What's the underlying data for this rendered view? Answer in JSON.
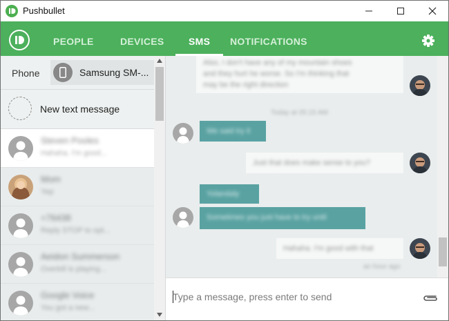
{
  "window": {
    "title": "Pushbullet"
  },
  "tabs": [
    {
      "label": "PEOPLE"
    },
    {
      "label": "DEVICES"
    },
    {
      "label": "SMS"
    },
    {
      "label": "NOTIFICATIONS"
    }
  ],
  "sidebar": {
    "phone_label": "Phone",
    "device_name": "Samsung SM-...",
    "new_message_label": "New text message",
    "contacts": [
      {
        "name": "Steven Pooles",
        "preview": "Hahaha. I'm good..."
      },
      {
        "name": "Mom",
        "preview": "Yep"
      },
      {
        "name": "+76438",
        "preview": "Reply STOP to opt..."
      },
      {
        "name": "Aeidon Summerson",
        "preview": "Overkill is playing..."
      },
      {
        "name": "Google Voice",
        "preview": "You got a new..."
      }
    ]
  },
  "chat": {
    "messages": [
      {
        "dir": "out",
        "text1": "Also, I don't have any of my mountain shoes",
        "text2": "and they hurt he worse. So I'm thinking that",
        "text3": "may be the right direction"
      },
      {
        "dir": "stamp",
        "text": "Today at 05:15 AM"
      },
      {
        "dir": "in",
        "text1": "We said try it"
      },
      {
        "dir": "out",
        "text1": "Just that does make sense to you?"
      },
      {
        "dir": "in",
        "text1": "Yolandaly"
      },
      {
        "dir": "in",
        "text1": "Sometimes you just have to try until"
      },
      {
        "dir": "out",
        "text1": "Hahaha. I'm good with that"
      },
      {
        "dir": "stamp",
        "text": "an hour ago"
      }
    ]
  },
  "compose": {
    "placeholder": "Type a message, press enter to send"
  },
  "colors": {
    "brand_green": "#4cb05c",
    "incoming_bubble": "#5aa2a2",
    "sidebar_bg": "#e8ecec"
  },
  "icons": {
    "titlebar": [
      "pushbullet-logo-icon",
      "minimize-icon",
      "maximize-icon",
      "close-icon"
    ],
    "toolbar": [
      "pushbullet-brand-icon",
      "gear-icon"
    ],
    "compose": [
      "paperclip-icon"
    ]
  }
}
